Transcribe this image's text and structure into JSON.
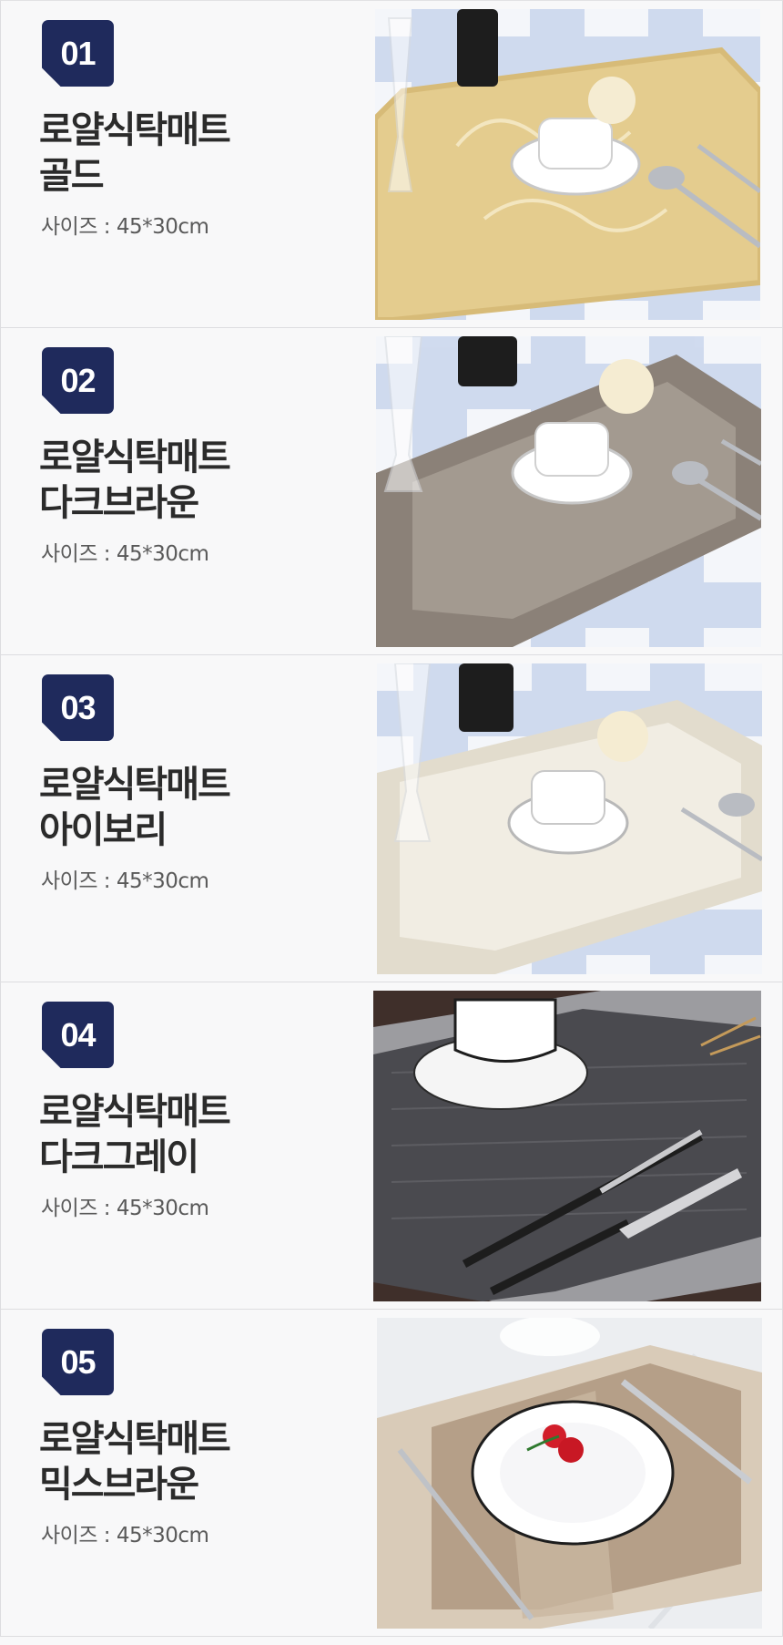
{
  "products": [
    {
      "number": "01",
      "title_line1": "로얄식탁매트",
      "title_line2": "골드",
      "size": "사이즈 : 45*30cm",
      "image_icon": "gold-placemat-photo",
      "mat_color": "#e4cc8e",
      "mat_border_color": "#d7bb78",
      "background_style": "blue-check"
    },
    {
      "number": "02",
      "title_line1": "로얄식탁매트",
      "title_line2": "다크브라운",
      "size": "사이즈 : 45*30cm",
      "image_icon": "dark-brown-placemat-photo",
      "mat_color": "#a39a90",
      "mat_border_color": "#8b8178",
      "background_style": "blue-check"
    },
    {
      "number": "03",
      "title_line1": "로얄식탁매트",
      "title_line2": "아이보리",
      "size": "사이즈 : 45*30cm",
      "image_icon": "ivory-placemat-photo",
      "mat_color": "#f1ede3",
      "mat_border_color": "#e2dccd",
      "background_style": "blue-check"
    },
    {
      "number": "04",
      "title_line1": "로얄식탁매트",
      "title_line2": "다크그레이",
      "size": "사이즈 : 45*30cm",
      "image_icon": "dark-gray-placemat-photo",
      "mat_color": "#4a4a4f",
      "mat_border_color": "#9c9ca0",
      "background_style": "dark-wood"
    },
    {
      "number": "05",
      "title_line1": "로얄식탁매트",
      "title_line2": "믹스브라운",
      "size": "사이즈 : 45*30cm",
      "image_icon": "mix-brown-placemat-photo",
      "mat_color": "#b59f88",
      "mat_border_color": "#d9cbb8",
      "background_style": "white-marble"
    }
  ],
  "colors": {
    "badge": "#1f2a5c",
    "title": "#2b2b2b",
    "size_text": "#5a5a5a",
    "card_background": "#f8f8f9"
  }
}
